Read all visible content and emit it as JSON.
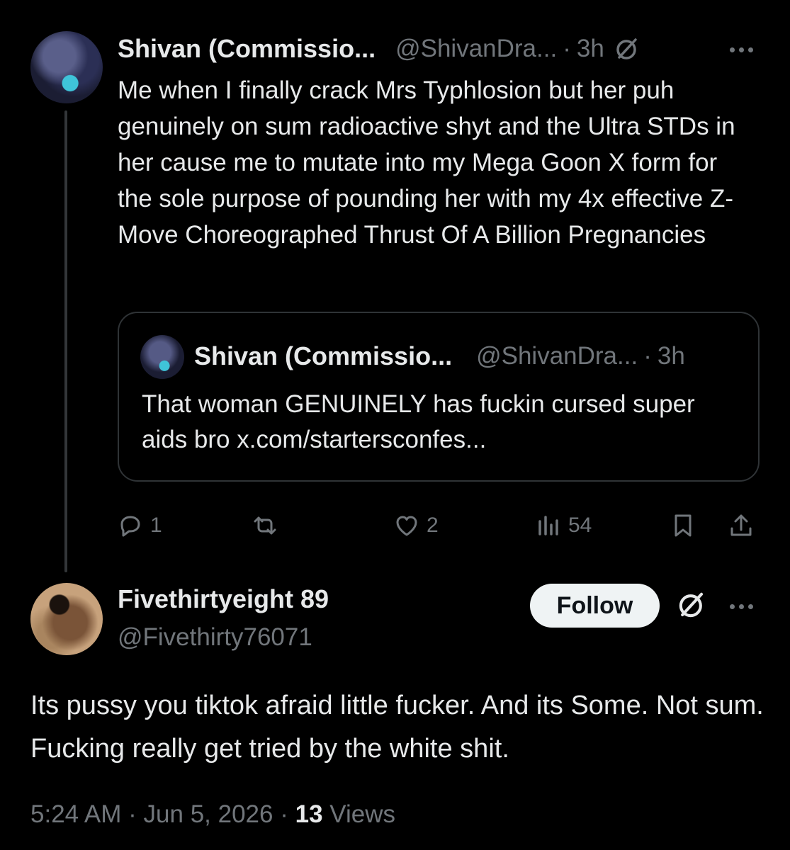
{
  "tweet": {
    "author_name": "Shivan (Commissio...",
    "author_handle": "@ShivanDra...",
    "separator": "·",
    "time": "3h",
    "text": "Me when I finally crack Mrs Typhlosion but her puh genuinely on sum radioactive shyt and the Ultra STDs in her cause me to mutate into my Mega Goon X form for the sole purpose of pounding her with my 4x effective Z-Move Choreographed Thrust Of A Billion Pregnancies",
    "quote": {
      "author_name": "Shivan (Commissio...",
      "author_handle": "@ShivanDra...",
      "separator": "·",
      "time": "3h",
      "text": "That woman GENUINELY has fuckin cursed super aids bro x.com/startersconfes..."
    },
    "actions": {
      "replies": "1",
      "likes": "2",
      "views": "54"
    }
  },
  "reply": {
    "author_name": "Fivethirtyeight 89",
    "author_handle": "@Fivethirty76071",
    "follow_label": "Follow",
    "text": "Its pussy you tiktok afraid little fucker. And its Some. Not sum. Fucking really get tried by the white shit.",
    "time": "5:24 AM",
    "date": "Jun 5, 2026",
    "separator": "·",
    "views_count": "13",
    "views_label": "Views"
  },
  "icons": {
    "reply": "reply-icon",
    "retweet": "retweet-icon",
    "like": "heart-icon",
    "views": "views-icon",
    "bookmark": "bookmark-icon",
    "share": "share-icon",
    "grok": "grok-icon",
    "more": "more-icon"
  },
  "colors": {
    "background": "#000000",
    "text": "#e7e9ea",
    "secondary": "#71767b",
    "border": "#2f3336",
    "follow_bg": "#eff3f4"
  }
}
